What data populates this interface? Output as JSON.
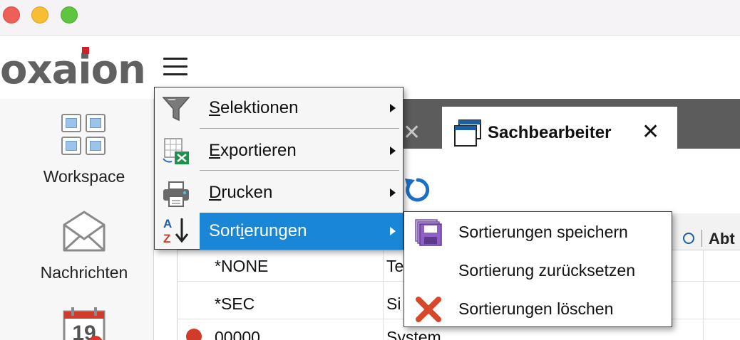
{
  "window": {
    "traffic_lights": [
      "close",
      "minimize",
      "maximize"
    ]
  },
  "app": {
    "logo_text": "oxaion"
  },
  "sidebar": {
    "items": [
      {
        "label": "Workspace",
        "icon": "workspace-grid-icon"
      },
      {
        "label": "Nachrichten",
        "icon": "envelope-icon"
      },
      {
        "label": "",
        "icon": "calendar-icon",
        "calendar_day": "19"
      }
    ]
  },
  "tabs": {
    "active_title": "Sachbearbeiter",
    "close_glyph": "✕",
    "inactive_close_glyph": "✕"
  },
  "grid": {
    "header_partial": "Abt",
    "rows": [
      {
        "code": "*NONE",
        "name": "Te"
      },
      {
        "code": "*SEC",
        "name": "Si"
      },
      {
        "code": "00000",
        "name": "System"
      }
    ]
  },
  "menu": {
    "items": [
      {
        "label_first": "S",
        "label_rest": "elektionen",
        "icon": "filter-funnel-icon"
      },
      {
        "label_first": "E",
        "label_rest": "xportieren",
        "icon": "excel-export-icon"
      },
      {
        "label_first": "D",
        "label_rest": "rucken",
        "icon": "printer-icon"
      },
      {
        "label_first": "Sort",
        "label_mid": "i",
        "label_rest": "erungen",
        "icon": "sort-az-icon"
      }
    ]
  },
  "submenu": {
    "items": [
      {
        "label": "Sortierungen speichern",
        "icon": "save-floppy-icon"
      },
      {
        "label": "Sortierung zurücksetzen",
        "icon": ""
      },
      {
        "label": "Sortierungen löschen",
        "icon": "delete-x-icon"
      }
    ]
  },
  "colors": {
    "menu_highlight": "#1a86d6",
    "tabbar": "#5c5c5c",
    "logo_accent": "#d0202a"
  }
}
